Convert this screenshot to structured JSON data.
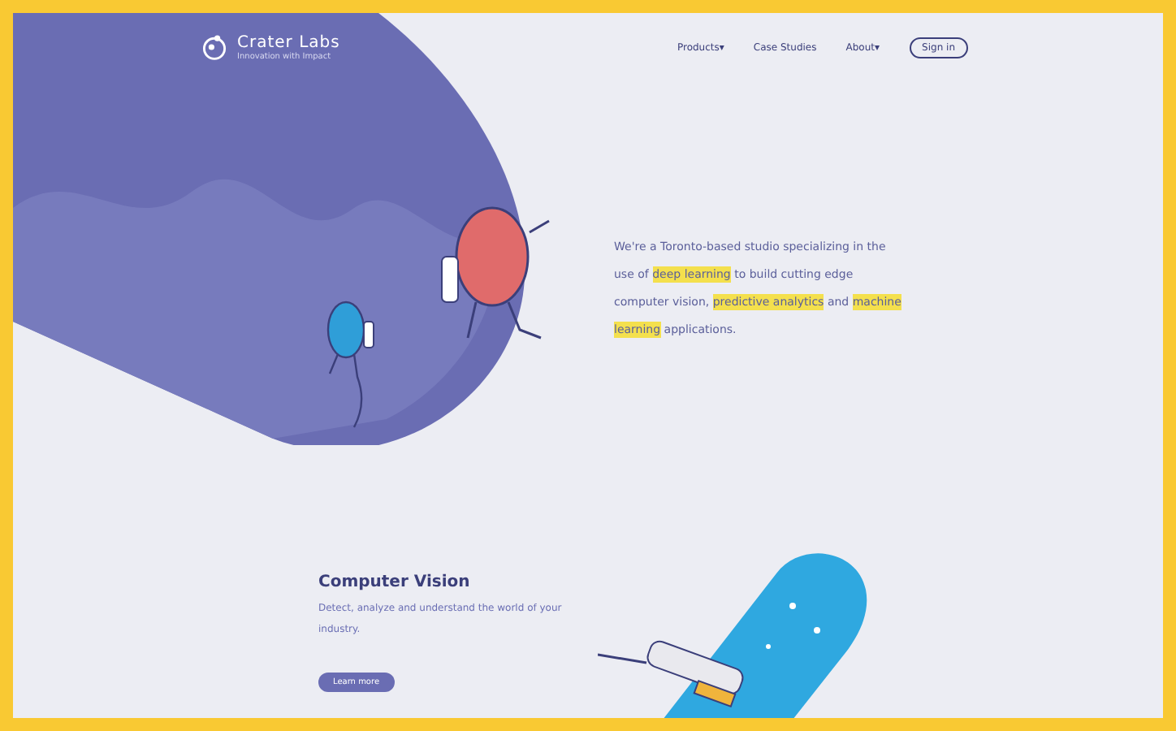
{
  "header": {
    "brand": "Crater Labs",
    "tagline": "Innovation with Impact",
    "nav": [
      {
        "label": "Products",
        "caret": "▾"
      },
      {
        "label": "Case Studies"
      },
      {
        "label": "About",
        "caret": "▾"
      }
    ],
    "sign_in": "Sign in"
  },
  "hero": {
    "intro": [
      {
        "text": "We're a Toronto-based studio specializing in the use of ",
        "highlight": false
      },
      {
        "text": "deep learning",
        "highlight": true
      },
      {
        "text": " to build cutting edge computer vision, ",
        "highlight": false
      },
      {
        "text": "predictive analytics",
        "highlight": true
      },
      {
        "text": " and ",
        "highlight": false
      },
      {
        "text": "machine learning",
        "highlight": true
      },
      {
        "text": " applications.",
        "highlight": false
      }
    ]
  },
  "feature": {
    "title": "Computer Vision",
    "text": "Detect, analyze and understand the world of your industry.",
    "button": "Learn more"
  }
}
